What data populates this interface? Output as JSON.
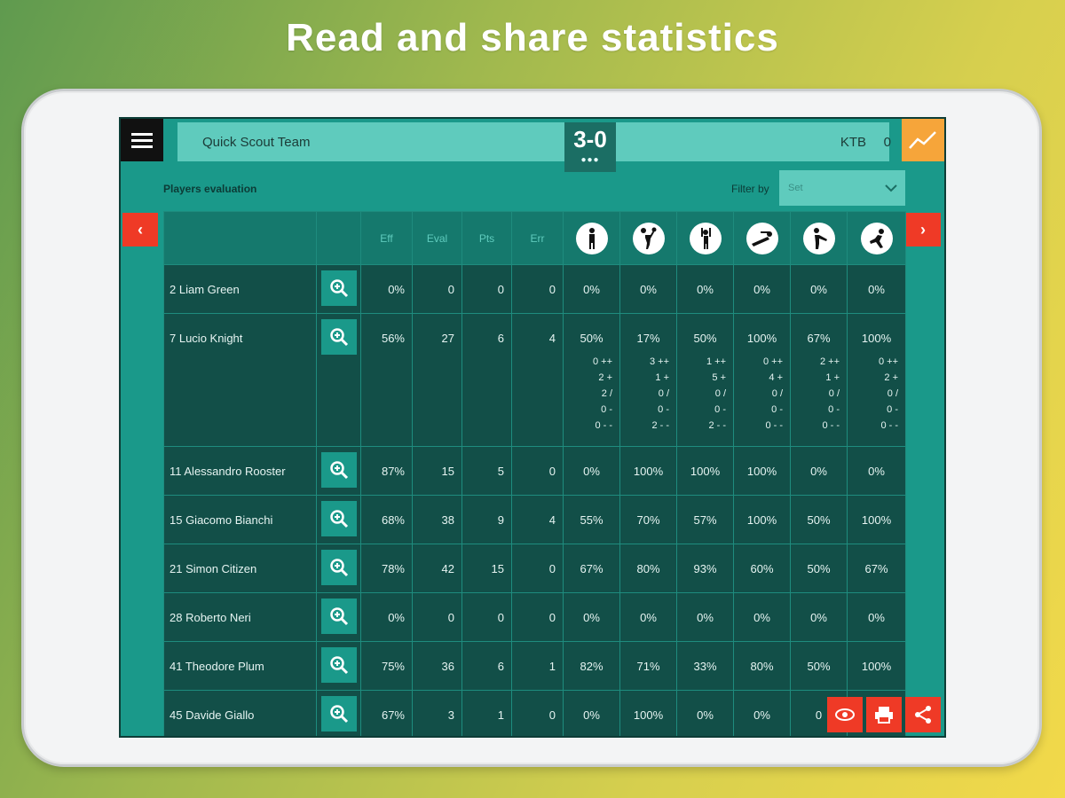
{
  "headline": "Read and share statistics",
  "header": {
    "home_team": "Quick Scout Team",
    "score": "3-0",
    "score_dots": "●●●",
    "away_team": "KTB",
    "away_extra": "0"
  },
  "section": {
    "title": "Players evaluation",
    "filter_label": "Filter by",
    "filter_value": "Set"
  },
  "table": {
    "columns": [
      "Eff",
      "Eval",
      "Pts",
      "Err"
    ],
    "skill_icons": [
      "serve-icon",
      "attack-icon",
      "block-icon",
      "dig-icon",
      "reception-icon",
      "set-icon"
    ],
    "rows": [
      {
        "name": "2 Liam Green",
        "eff": "0%",
        "eval": "0",
        "pts": "0",
        "err": "0",
        "skills": [
          "0%",
          "0%",
          "0%",
          "0%",
          "0%",
          "0%"
        ]
      },
      {
        "name": "7 Lucio Knight",
        "eff": "56%",
        "eval": "27",
        "pts": "6",
        "err": "4",
        "skills": [
          "50%",
          "17%",
          "50%",
          "100%",
          "67%",
          "100%"
        ],
        "details": [
          [
            "0 ++",
            "2 +",
            "2 /",
            "0 -",
            "0 - -"
          ],
          [
            "3 ++",
            "1 +",
            "0 /",
            "0 -",
            "2 - -"
          ],
          [
            "1 ++",
            "5 +",
            "0 /",
            "0 -",
            "2 - -"
          ],
          [
            "0 ++",
            "4 +",
            "0 /",
            "0 -",
            "0 - -"
          ],
          [
            "2 ++",
            "1 +",
            "0 /",
            "0 -",
            "0 - -"
          ],
          [
            "0 ++",
            "2 +",
            "0 /",
            "0 -",
            "0 - -"
          ]
        ]
      },
      {
        "name": "11 Alessandro Rooster",
        "eff": "87%",
        "eval": "15",
        "pts": "5",
        "err": "0",
        "skills": [
          "0%",
          "100%",
          "100%",
          "100%",
          "0%",
          "0%"
        ]
      },
      {
        "name": "15 Giacomo Bianchi",
        "eff": "68%",
        "eval": "38",
        "pts": "9",
        "err": "4",
        "skills": [
          "55%",
          "70%",
          "57%",
          "100%",
          "50%",
          "100%"
        ]
      },
      {
        "name": "21 Simon Citizen",
        "eff": "78%",
        "eval": "42",
        "pts": "15",
        "err": "0",
        "skills": [
          "67%",
          "80%",
          "93%",
          "60%",
          "50%",
          "67%"
        ]
      },
      {
        "name": "28 Roberto Neri",
        "eff": "0%",
        "eval": "0",
        "pts": "0",
        "err": "0",
        "skills": [
          "0%",
          "0%",
          "0%",
          "0%",
          "0%",
          "0%"
        ]
      },
      {
        "name": "41 Theodore Plum",
        "eff": "75%",
        "eval": "36",
        "pts": "6",
        "err": "1",
        "skills": [
          "82%",
          "71%",
          "33%",
          "80%",
          "50%",
          "100%"
        ]
      },
      {
        "name": "45 Davide Giallo",
        "eff": "67%",
        "eval": "3",
        "pts": "1",
        "err": "0",
        "skills": [
          "0%",
          "100%",
          "0%",
          "0%",
          "0",
          ""
        ]
      }
    ]
  },
  "colors": {
    "screen_bg": "#1a998a",
    "row_bg": "#124f48",
    "header_bar": "#5fcbbd",
    "accent_orange": "#f6a53a",
    "accent_red": "#ef3a26"
  }
}
